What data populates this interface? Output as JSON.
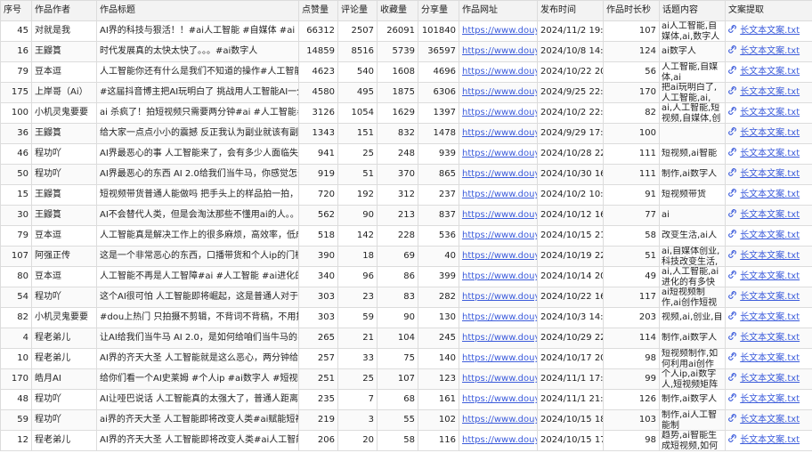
{
  "columns": [
    "序号",
    "作品作者",
    "作品标题",
    "点赞量",
    "评论量",
    "收藏量",
    "分享量",
    "作品网址",
    "发布时间",
    "作品时长秒",
    "话题内容",
    "文案提取"
  ],
  "rows": [
    {
      "id": "45",
      "author": "对就是我",
      "title": "AI界的科技与狠活！！#ai人工智能 #自媒体 #ai #数",
      "likes": "66312",
      "comments": "2507",
      "favs": "26091",
      "shares": "101840",
      "url": "https://www.douyin",
      "time": "2024/11/2 19:19",
      "dur": "107",
      "topic": "ai人工智能,自媒体,ai,数字人",
      "file": "长文本文案.txt"
    },
    {
      "id": "16",
      "author": "王鼹篔",
      "title": "时代发展真的太快太快了。。。#ai数字人",
      "likes": "14859",
      "comments": "8516",
      "favs": "5739",
      "shares": "36597",
      "url": "https://www.douyin",
      "time": "2024/10/8 14:24",
      "dur": "124",
      "topic": "ai数字人",
      "file": "长文本文案.txt"
    },
    {
      "id": "79",
      "author": "豆本逗",
      "title": "人工智能你还有什么是我们不知道的操作#人工智能",
      "likes": "4623",
      "comments": "540",
      "favs": "1608",
      "shares": "4696",
      "url": "https://www.douyin",
      "time": "2024/10/22 20:05",
      "dur": "56",
      "topic": "人工智能,自媒体,ai",
      "file": "长文本文案.txt"
    },
    {
      "id": "175",
      "author": "上岸哥（Ai）",
      "title": "#这届抖音博主把AI玩明白了 挑战用人工智能AI一分",
      "likes": "4580",
      "comments": "495",
      "favs": "1875",
      "shares": "6306",
      "url": "https://www.douyin",
      "time": "2024/9/25 22:38",
      "dur": "170",
      "topic": "把ai玩明白了,人工智能,ai,",
      "file": "长文本文案.txt"
    },
    {
      "id": "100",
      "author": "小机灵鬼要要",
      "title": "ai 杀疯了！拍短视频只需要两分钟#ai #人工智能#短",
      "likes": "3126",
      "comments": "1054",
      "favs": "1629",
      "shares": "1397",
      "url": "https://www.douyin",
      "time": "2024/10/2 22:15",
      "dur": "82",
      "topic": "ai,人工智能,短视频,自媒体,创",
      "file": "长文本文案.txt"
    },
    {
      "id": "36",
      "author": "王鼹篔",
      "title": "给大家一点点小小的震撼 反正我认为副业就该有副业",
      "likes": "1343",
      "comments": "151",
      "favs": "832",
      "shares": "1478",
      "url": "https://www.douyin",
      "time": "2024/9/29 17:20",
      "dur": "100",
      "topic": "",
      "file": "长文本文案.txt"
    },
    {
      "id": "46",
      "author": "程功吖",
      "title": "AI界最恶心的事 人工智能来了，会有多少人面临失业",
      "likes": "941",
      "comments": "25",
      "favs": "248",
      "shares": "939",
      "url": "https://www.douyin",
      "time": "2024/10/28 22:11",
      "dur": "111",
      "topic": "短视频,ai智能",
      "file": "长文本文案.txt"
    },
    {
      "id": "50",
      "author": "程功吖",
      "title": "AI界最恶心的东西 AI 2.0给我们当牛马，你感觉怎么",
      "likes": "919",
      "comments": "51",
      "favs": "370",
      "shares": "865",
      "url": "https://www.douyin",
      "time": "2024/10/30 16:05",
      "dur": "111",
      "topic": "制作,ai数字人",
      "file": "长文本文案.txt"
    },
    {
      "id": "15",
      "author": "王鼹篔",
      "title": "短视频带货普通人能做吗 把手头上的样品拍一拍，我",
      "likes": "720",
      "comments": "192",
      "favs": "312",
      "shares": "237",
      "url": "https://www.douyin",
      "time": "2024/10/2 10:35",
      "dur": "91",
      "topic": "短视频带货",
      "file": "长文本文案.txt"
    },
    {
      "id": "30",
      "author": "王鼹篔",
      "title": "AI不会替代人类，但是会淘汰那些不懂用ai的人。。",
      "likes": "562",
      "comments": "90",
      "favs": "213",
      "shares": "837",
      "url": "https://www.douyin",
      "time": "2024/10/12 16:58",
      "dur": "77",
      "topic": "ai",
      "file": "长文本文案.txt"
    },
    {
      "id": "79",
      "author": "豆本逗",
      "title": "人工智能真是解决工作上的很多麻烦，高效率，低成",
      "likes": "518",
      "comments": "142",
      "favs": "228",
      "shares": "536",
      "url": "https://www.douyin",
      "time": "2024/10/15 21:17",
      "dur": "58",
      "topic": "改变生活,ai人",
      "file": "长文本文案.txt"
    },
    {
      "id": "107",
      "author": "阿强正传",
      "title": "这是一个非常恶心的东西，口播带货和个人ip的门槛",
      "likes": "390",
      "comments": "18",
      "favs": "69",
      "shares": "40",
      "url": "https://www.douyin",
      "time": "2024/10/19 22:16",
      "dur": "51",
      "topic": "ai,自媒体创业,科技改变生活,",
      "file": "长文本文案.txt"
    },
    {
      "id": "80",
      "author": "豆本逗",
      "title": "人工智能不再是人工智障#ai #人工智能 #ai进化的有",
      "likes": "340",
      "comments": "96",
      "favs": "86",
      "shares": "399",
      "url": "https://www.douyin",
      "time": "2024/10/14 20:17",
      "dur": "49",
      "topic": "ai,人工智能,ai进化的有多快",
      "file": "长文本文案.txt"
    },
    {
      "id": "54",
      "author": "程功吖",
      "title": "这个AI很可怕 人工智能即将崛起，这是普通人对于自",
      "likes": "303",
      "comments": "23",
      "favs": "83",
      "shares": "282",
      "url": "https://www.douyin",
      "time": "2024/10/22 16:27",
      "dur": "117",
      "topic": "ai短视频制作,ai创作短视",
      "file": "长文本文案.txt"
    },
    {
      "id": "82",
      "author": "小机灵鬼要要",
      "title": "#dou上热门 只拍摄不剪辑，不背词不背稿，不用提词",
      "likes": "303",
      "comments": "59",
      "favs": "90",
      "shares": "130",
      "url": "https://www.douyin",
      "time": "2024/10/3 14:06",
      "dur": "203",
      "topic": "视频,ai,创业,自",
      "file": "长文本文案.txt"
    },
    {
      "id": "4",
      "author": "程老弟儿",
      "title": "让AI给我们当牛马 AI 2.0，是如何给咱们当牛马的#",
      "likes": "265",
      "comments": "21",
      "favs": "104",
      "shares": "245",
      "url": "https://www.douyin",
      "time": "2024/10/29 22:22",
      "dur": "114",
      "topic": "制作,ai数字人",
      "file": "长文本文案.txt"
    },
    {
      "id": "10",
      "author": "程老弟儿",
      "title": "AI界的齐天大圣 人工智能就是这么恶心，两分钟给你",
      "likes": "257",
      "comments": "33",
      "favs": "75",
      "shares": "140",
      "url": "https://www.douyin",
      "time": "2024/10/17 20:13",
      "dur": "98",
      "topic": "短视频制作,如何利用ai创作",
      "file": "长文本文案.txt"
    },
    {
      "id": "170",
      "author": "皓月AI",
      "title": "给你们看一个AI史莱姆 #个人ip #ai数字人 #短视频",
      "likes": "251",
      "comments": "25",
      "favs": "107",
      "shares": "123",
      "url": "https://www.douyin",
      "time": "2024/11/1 17:44",
      "dur": "99",
      "topic": "个人ip,ai数字人,短视频矩阵",
      "file": "长文本文案.txt"
    },
    {
      "id": "48",
      "author": "程功吖",
      "title": "AI让哑巴说话 人工智能真的太强大了，普通人距离真",
      "likes": "235",
      "comments": "7",
      "favs": "68",
      "shares": "161",
      "url": "https://www.douyin",
      "time": "2024/11/1 21:29",
      "dur": "126",
      "topic": "制作,ai数字人",
      "file": "长文本文案.txt"
    },
    {
      "id": "59",
      "author": "程功吖",
      "title": "ai界的齐天大圣 人工智能即将改变人类#ai赋能短视",
      "likes": "219",
      "comments": "3",
      "favs": "55",
      "shares": "102",
      "url": "https://www.douyin",
      "time": "2024/10/15 18:24",
      "dur": "103",
      "topic": "制作,ai人工智能制",
      "file": "长文本文案.txt"
    },
    {
      "id": "12",
      "author": "程老弟儿",
      "title": "AI界的齐天大圣 人工智能即将改变人类#ai人工智能",
      "likes": "206",
      "comments": "20",
      "favs": "58",
      "shares": "116",
      "url": "https://www.douyin",
      "time": "2024/10/15 17:14",
      "dur": "98",
      "topic": "趋势,ai智能生成短视频,如何",
      "file": "长文本文案.txt"
    }
  ]
}
